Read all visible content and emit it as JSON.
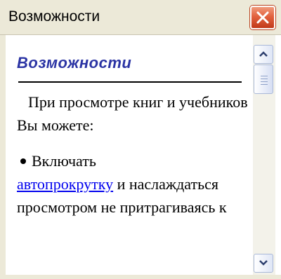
{
  "window": {
    "title": "Возможности",
    "close_icon": "close-icon"
  },
  "content": {
    "heading": "Возможности",
    "paragraph1": "При просмотре книг и учебников Вы можете:",
    "bullet": {
      "prefix": "Включать",
      "link_text": "автопрокрутку",
      "suffix": "и наслаждаться просмотром не притрагиваясь к"
    }
  },
  "scrollbar": {
    "up_icon": "arrow-up-icon",
    "down_icon": "arrow-down-icon"
  },
  "colors": {
    "heading": "#2b34a4",
    "link": "#0000ee",
    "close_button": "#e2613e",
    "frame": "#ece9d8"
  }
}
